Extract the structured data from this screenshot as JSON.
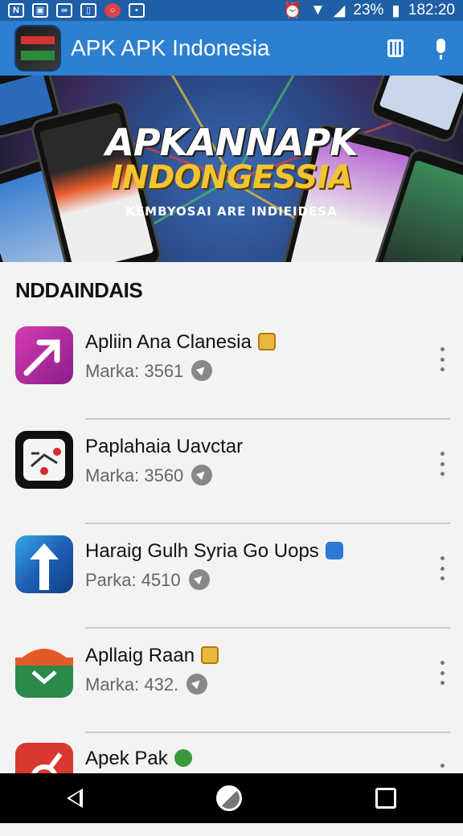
{
  "status_bar": {
    "battery": "23%",
    "time": "182:20"
  },
  "app_bar": {
    "title": "APK APK Indonesia"
  },
  "banner": {
    "line1": "APKANNAPK",
    "line2": "INDONGESSIA",
    "line3": "KEMBYOSAI ARE INDIEIDESA"
  },
  "section": {
    "title": "NDDAINDAIS"
  },
  "apps": [
    {
      "name": "Apliin Ana Clanesia",
      "meta": "Marka: 3561",
      "badge": "gold",
      "icon": "arrow-icon",
      "color": "#c02ea3"
    },
    {
      "name": "Paplahaia Uavctar",
      "meta": "Marka: 3560",
      "badge": "",
      "icon": "routes-icon",
      "color": "#111111"
    },
    {
      "name": "Haraig Gulh Syria Go Uops",
      "meta": "Parka: 4510",
      "badge": "blue",
      "icon": "upload-icon",
      "color": "#1e5fb5"
    },
    {
      "name": "Apllaig Raan",
      "meta": "Marka: 432.",
      "badge": "gold",
      "icon": "mail-icon",
      "color": "#2b8a4a"
    },
    {
      "name": "Apek Pak",
      "meta": "",
      "badge": "green",
      "icon": "fruit-icon",
      "color": "#d8392f"
    }
  ]
}
